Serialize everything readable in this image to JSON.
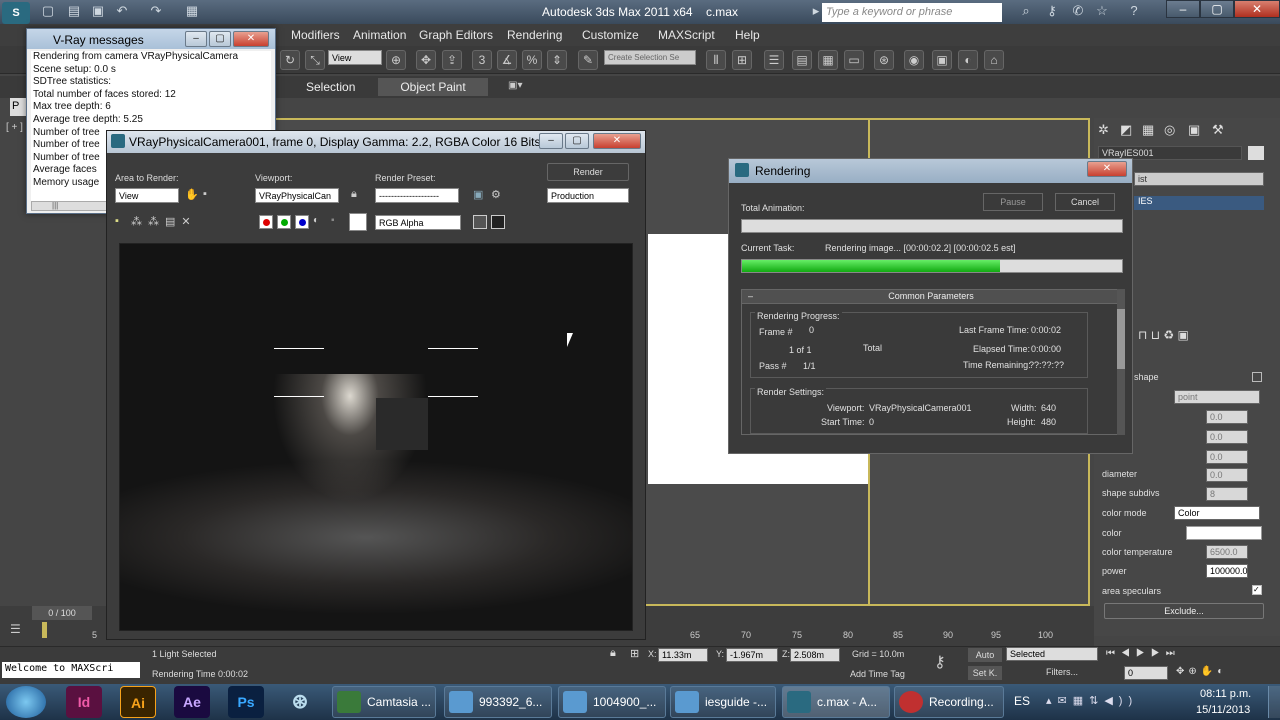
{
  "app": {
    "title": "Autodesk 3ds Max  2011 x64",
    "file": "c.max",
    "search_placeholder": "Type a keyword or phrase"
  },
  "menu": [
    "Modifiers",
    "Animation",
    "Graph Editors",
    "Rendering",
    "Customize",
    "MAXScript",
    "Help"
  ],
  "toolbar": {
    "view_dropdown": "View",
    "selection_set_placeholder": "Create Selection Se"
  },
  "ribbon_tabs": [
    "Selection",
    "Object Paint"
  ],
  "vray_messages": {
    "title": "V-Ray messages",
    "lines": [
      "Rendering from camera VRayPhysicalCamera",
      "Scene setup: 0.0 s",
      "SDTree statistics:",
      "Total number of faces stored: 12",
      "Max tree depth: 6",
      "Average tree depth: 5.25",
      "Number of tree",
      "Number of tree",
      "Number of tree",
      "Average faces",
      "Memory usage"
    ]
  },
  "vfb": {
    "title": "VRayPhysicalCamera001, frame 0, Display Gamma: 2.2, RGBA Color 16 Bits/C...",
    "area_label": "Area to Render:",
    "area_value": "View",
    "viewport_label": "Viewport:",
    "viewport_value": "VRayPhysicalCan",
    "preset_label": "Render Preset:",
    "preset_value": "--------------------",
    "render_btn": "Render",
    "production": "Production",
    "channel": "RGB Alpha"
  },
  "rendering": {
    "title": "Rendering",
    "total_animation": "Total Animation:",
    "pause": "Pause",
    "cancel": "Cancel",
    "current_task_label": "Current Task:",
    "current_task": "Rendering image... [00:00:02.2] [00:00:02.5 est]",
    "progress": 0.68,
    "common_params": "Common Parameters",
    "rendering_progress": "Rendering Progress:",
    "frame_label": "Frame #",
    "frame_value": "0",
    "of_text": "1  of  1",
    "total": "Total",
    "pass_label": "Pass #",
    "pass_value": "1/1",
    "last_frame_label": "Last Frame Time:",
    "last_frame_value": "0:00:02",
    "elapsed_label": "Elapsed Time:",
    "elapsed_value": "0:00:00",
    "remaining_label": "Time Remaining:",
    "remaining_value": "??:??:??",
    "render_settings": "Render Settings:",
    "viewport_label": "Viewport:",
    "viewport_value": "VRayPhysicalCamera001",
    "width_label": "Width:",
    "width_value": "640",
    "start_label": "Start Time:",
    "start_value": "0",
    "height_label": "Height:",
    "height_value": "480"
  },
  "cmdpanel": {
    "object_name": "VRayIES001",
    "list_value": "ist",
    "list_item": "IES",
    "shape_label": "shape",
    "point_value": "point",
    "fields": [
      {
        "label": "",
        "value": "0.0"
      },
      {
        "label": "",
        "value": "0.0"
      },
      {
        "label": "",
        "value": "0.0"
      },
      {
        "label": "diameter",
        "value": "0.0"
      },
      {
        "label": "shape subdivs",
        "value": "8"
      }
    ],
    "color_mode_label": "color mode",
    "color_mode_value": "Color",
    "color_label": "color",
    "temp_label": "color temperature",
    "temp_value": "6500.0",
    "power_label": "power",
    "power_value": "100000.0",
    "area_spec_label": "area speculars",
    "exclude": "Exclude..."
  },
  "timeline": {
    "frame": "0 / 100",
    "ticks": [
      "5",
      "65",
      "70",
      "75",
      "80",
      "85",
      "90",
      "95",
      "100"
    ]
  },
  "status": {
    "maxscript": "Welcome to MAXScri",
    "selected": "1 Light Selected",
    "render_time": "Rendering Time  0:00:02",
    "x": "11.33m",
    "y": "-1.967m",
    "z": "2.508m",
    "grid": "Grid = 10.0m",
    "add_time_tag": "Add Time Tag",
    "auto": "Auto",
    "set_k": "Set K.",
    "selected_dd": "Selected",
    "filters": "Filters...",
    "frame_field": "0"
  },
  "taskbar": {
    "buttons": [
      "Camtasia ...",
      "993392_6...",
      "1004900_...",
      "iesguide -...",
      "c.max - A...",
      "Recording..."
    ],
    "lang": "ES",
    "time": "08:11 p.m.",
    "date": "15/11/2013"
  },
  "colors": {
    "accent_green": "#2ec42e",
    "viewport_border": "#c8b85a"
  }
}
